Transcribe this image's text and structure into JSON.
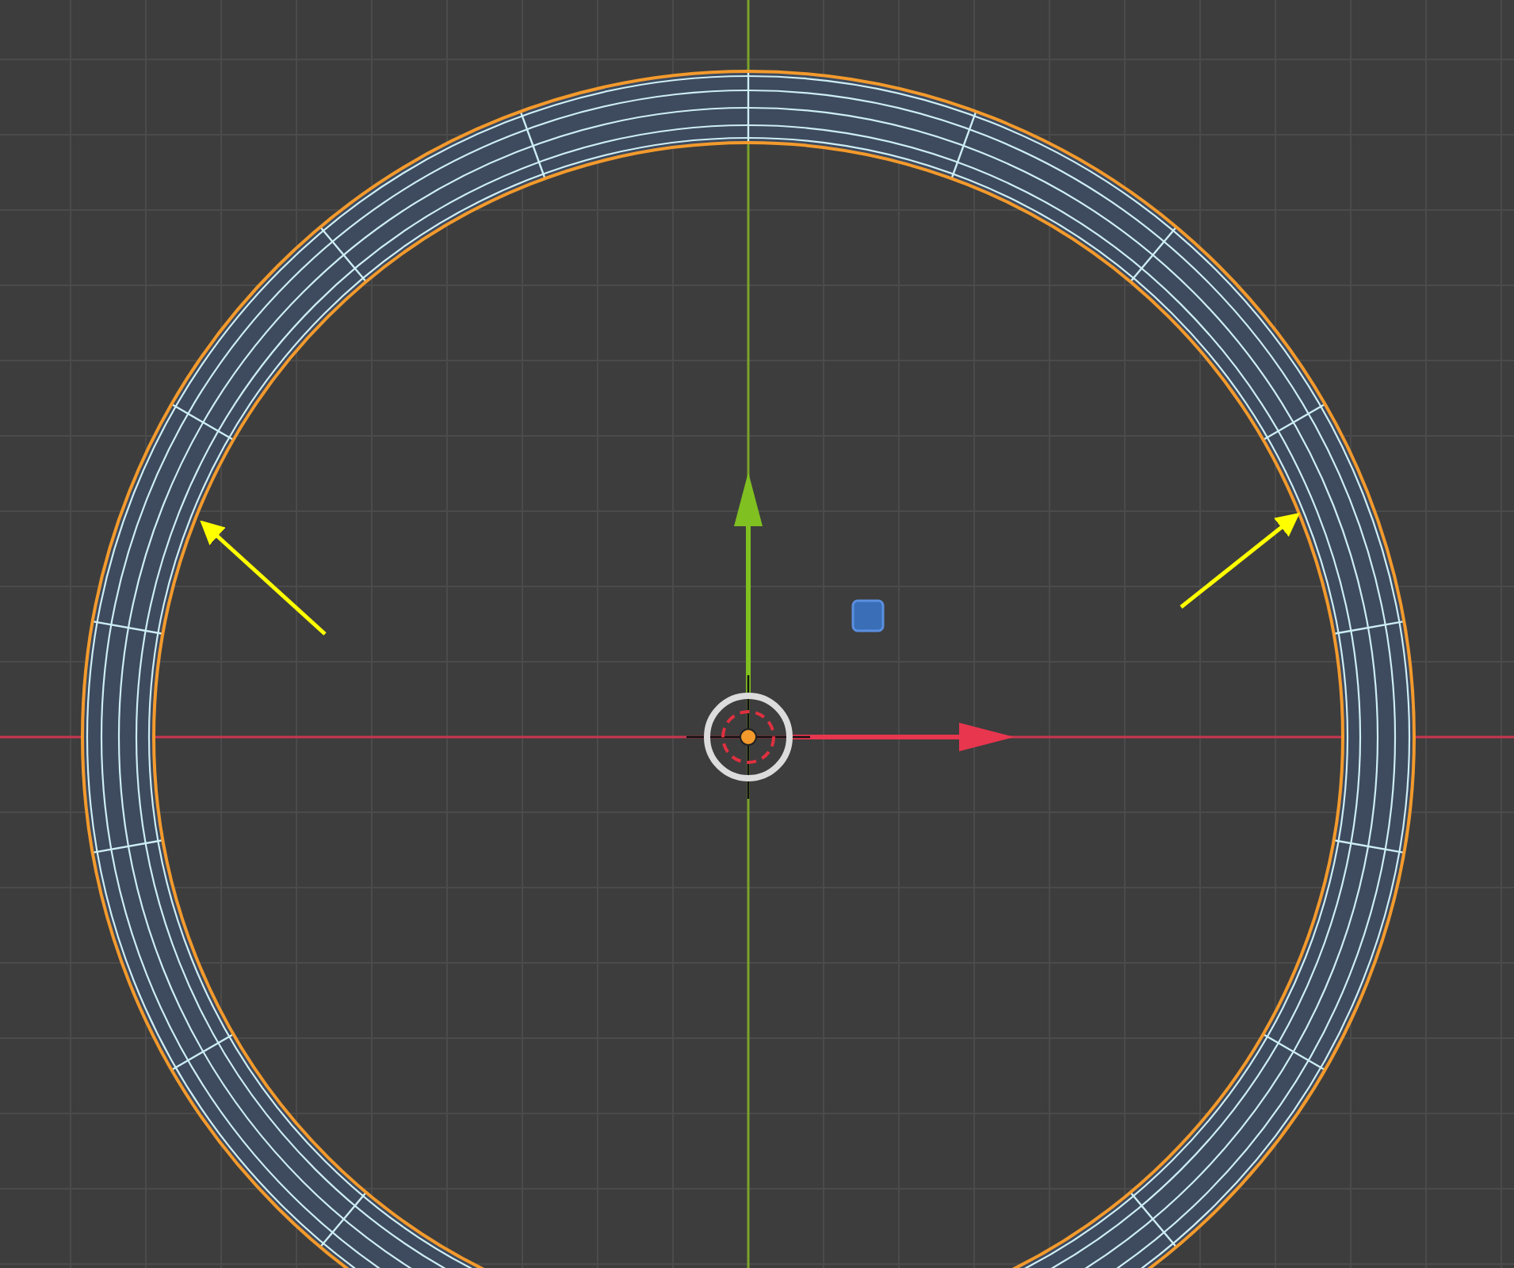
{
  "viewport": {
    "grid": true,
    "axes": true,
    "ring_selected": true,
    "annotations": [
      {
        "kind": "arrow"
      },
      {
        "kind": "arrow"
      }
    ]
  }
}
